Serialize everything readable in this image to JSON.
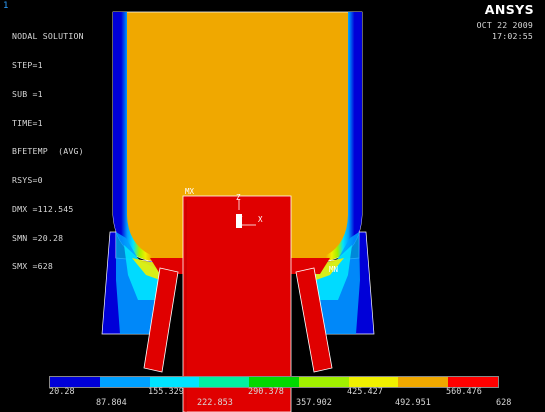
{
  "window_number": "1",
  "info": {
    "title": "NODAL SOLUTION",
    "lines": [
      "STEP=1",
      "SUB =1",
      "TIME=1",
      "BFETEMP  (AVG)",
      "RSYS=0",
      "DMX =112.545",
      "SMN =20.28",
      "SMX =628"
    ]
  },
  "brand": {
    "logo": "ANSYS"
  },
  "timestamp": {
    "date": "OCT 22 2009",
    "time": "17:02:55"
  },
  "markers": {
    "mx": "MX",
    "mn": "MN"
  },
  "triad": {
    "z": "Z",
    "y": "Y",
    "x": "X"
  },
  "legend": {
    "colors": [
      "#0000d8",
      "#00a0ff",
      "#00e4ff",
      "#00f0a0",
      "#00d800",
      "#a0f000",
      "#f0f000",
      "#f0a800",
      "#ff0000"
    ],
    "upper_labels": [
      "20.28",
      "155.329",
      "290.378",
      "425.427",
      "560.476"
    ],
    "lower_labels": [
      "87.804",
      "222.853",
      "357.902",
      "492.951",
      "628"
    ]
  }
}
